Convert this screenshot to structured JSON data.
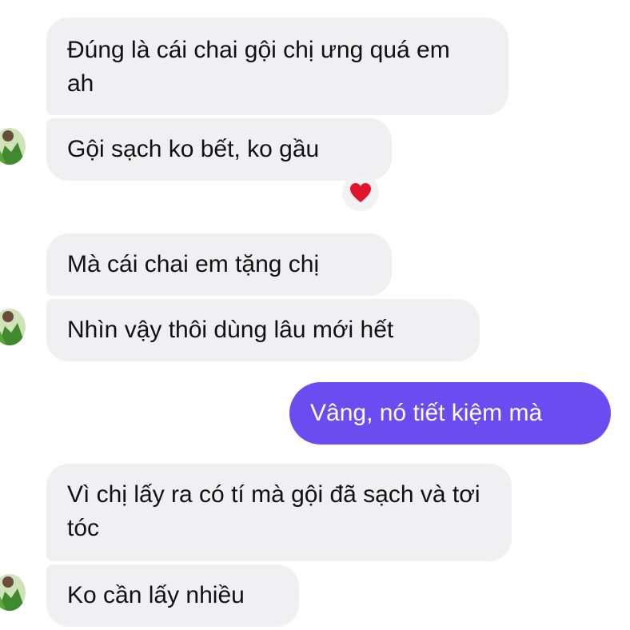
{
  "conversation": {
    "messages": [
      {
        "text": "Đúng là cái chai gội chị ưng quá em ah",
        "direction": "incoming"
      },
      {
        "text": "Gội sạch ko bết, ko gầu",
        "direction": "incoming",
        "reaction": "heart-icon"
      },
      {
        "text": "Mà cái chai em tặng chị",
        "direction": "incoming"
      },
      {
        "text": "Nhìn vậy thôi dùng lâu mới hết",
        "direction": "incoming"
      },
      {
        "text": "Vâng, nó tiết kiệm mà",
        "direction": "outgoing"
      },
      {
        "text": "Vì chị lấy ra có tí mà gội đã sạch và tơi tóc",
        "direction": "incoming"
      },
      {
        "text": "Ko cần lấy nhiều",
        "direction": "incoming"
      }
    ]
  },
  "colors": {
    "incoming_bubble": "#f0f0f2",
    "outgoing_bubble": "#6a4cf0",
    "reaction_heart": "#e0142b"
  }
}
